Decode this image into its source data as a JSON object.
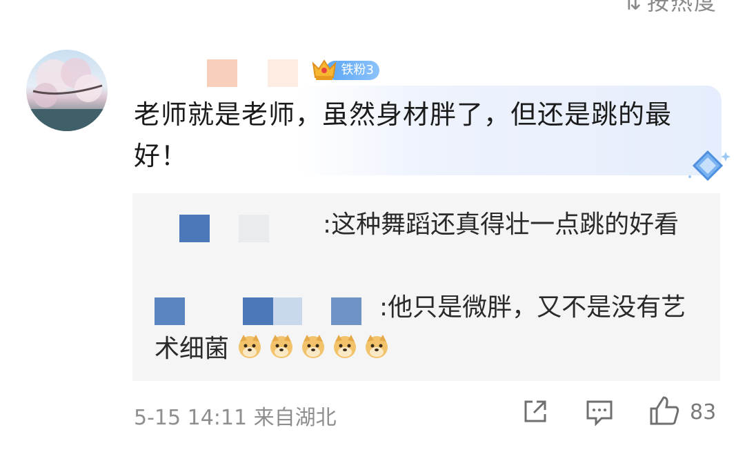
{
  "header": {
    "sort_label": "按热度"
  },
  "comment": {
    "badge_label": "铁粉3",
    "text": "老师就是老师，虽然身材胖了，但还是跳的最好！"
  },
  "replies": [
    {
      "text": ":这种舞蹈还真得壮一点跳的好看"
    },
    {
      "text": ":他只是微胖，又不是没有艺术细菌",
      "emoji_count": 5,
      "emoji_name": "doge-emoji"
    }
  ],
  "footer": {
    "meta": "5-15 14:11 来自湖北",
    "like_count": "83"
  },
  "colors": {
    "badge": "#5aa6f5",
    "reply_bg": "#f5f5f5",
    "mosaic_blue": "#4a78b8"
  },
  "icons": [
    "sort-icon",
    "crown-icon",
    "diamond-icon",
    "share-icon",
    "comment-icon",
    "like-icon"
  ]
}
